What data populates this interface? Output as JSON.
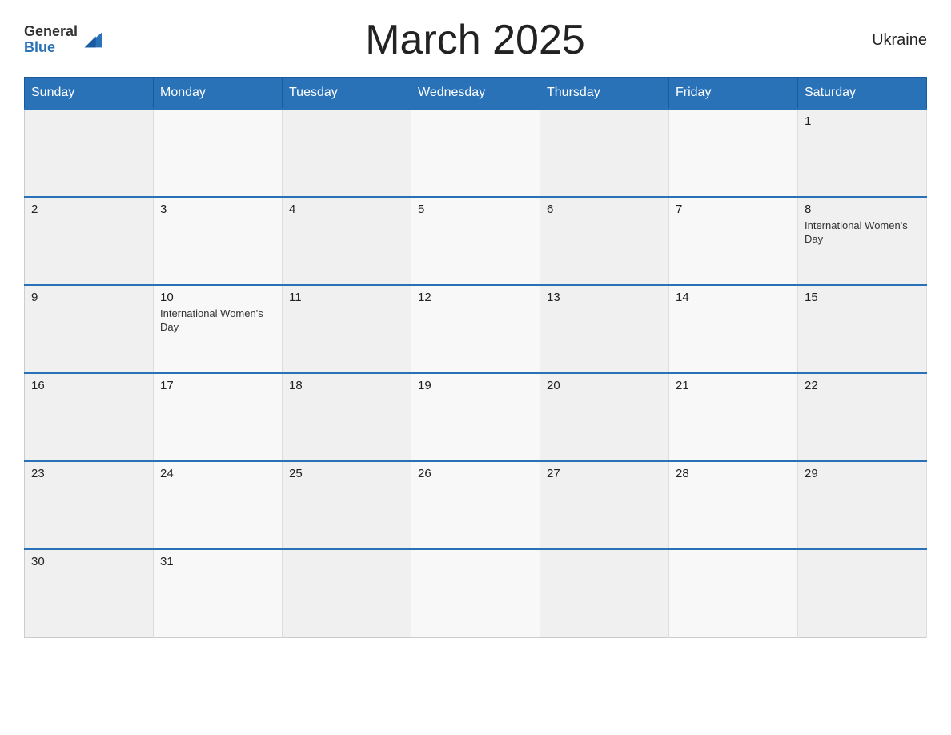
{
  "header": {
    "logo_general": "General",
    "logo_blue": "Blue",
    "month_title": "March 2025",
    "country": "Ukraine"
  },
  "days_of_week": [
    "Sunday",
    "Monday",
    "Tuesday",
    "Wednesday",
    "Thursday",
    "Friday",
    "Saturday"
  ],
  "weeks": [
    [
      {
        "day": "",
        "events": []
      },
      {
        "day": "",
        "events": []
      },
      {
        "day": "",
        "events": []
      },
      {
        "day": "",
        "events": []
      },
      {
        "day": "",
        "events": []
      },
      {
        "day": "",
        "events": []
      },
      {
        "day": "1",
        "events": []
      }
    ],
    [
      {
        "day": "2",
        "events": []
      },
      {
        "day": "3",
        "events": []
      },
      {
        "day": "4",
        "events": []
      },
      {
        "day": "5",
        "events": []
      },
      {
        "day": "6",
        "events": []
      },
      {
        "day": "7",
        "events": []
      },
      {
        "day": "8",
        "events": [
          "International Women's Day"
        ]
      }
    ],
    [
      {
        "day": "9",
        "events": []
      },
      {
        "day": "10",
        "events": [
          "International Women's Day"
        ]
      },
      {
        "day": "11",
        "events": []
      },
      {
        "day": "12",
        "events": []
      },
      {
        "day": "13",
        "events": []
      },
      {
        "day": "14",
        "events": []
      },
      {
        "day": "15",
        "events": []
      }
    ],
    [
      {
        "day": "16",
        "events": []
      },
      {
        "day": "17",
        "events": []
      },
      {
        "day": "18",
        "events": []
      },
      {
        "day": "19",
        "events": []
      },
      {
        "day": "20",
        "events": []
      },
      {
        "day": "21",
        "events": []
      },
      {
        "day": "22",
        "events": []
      }
    ],
    [
      {
        "day": "23",
        "events": []
      },
      {
        "day": "24",
        "events": []
      },
      {
        "day": "25",
        "events": []
      },
      {
        "day": "26",
        "events": []
      },
      {
        "day": "27",
        "events": []
      },
      {
        "day": "28",
        "events": []
      },
      {
        "day": "29",
        "events": []
      }
    ],
    [
      {
        "day": "30",
        "events": []
      },
      {
        "day": "31",
        "events": []
      },
      {
        "day": "",
        "events": []
      },
      {
        "day": "",
        "events": []
      },
      {
        "day": "",
        "events": []
      },
      {
        "day": "",
        "events": []
      },
      {
        "day": "",
        "events": []
      }
    ]
  ],
  "accent_color": "#2a72b8"
}
